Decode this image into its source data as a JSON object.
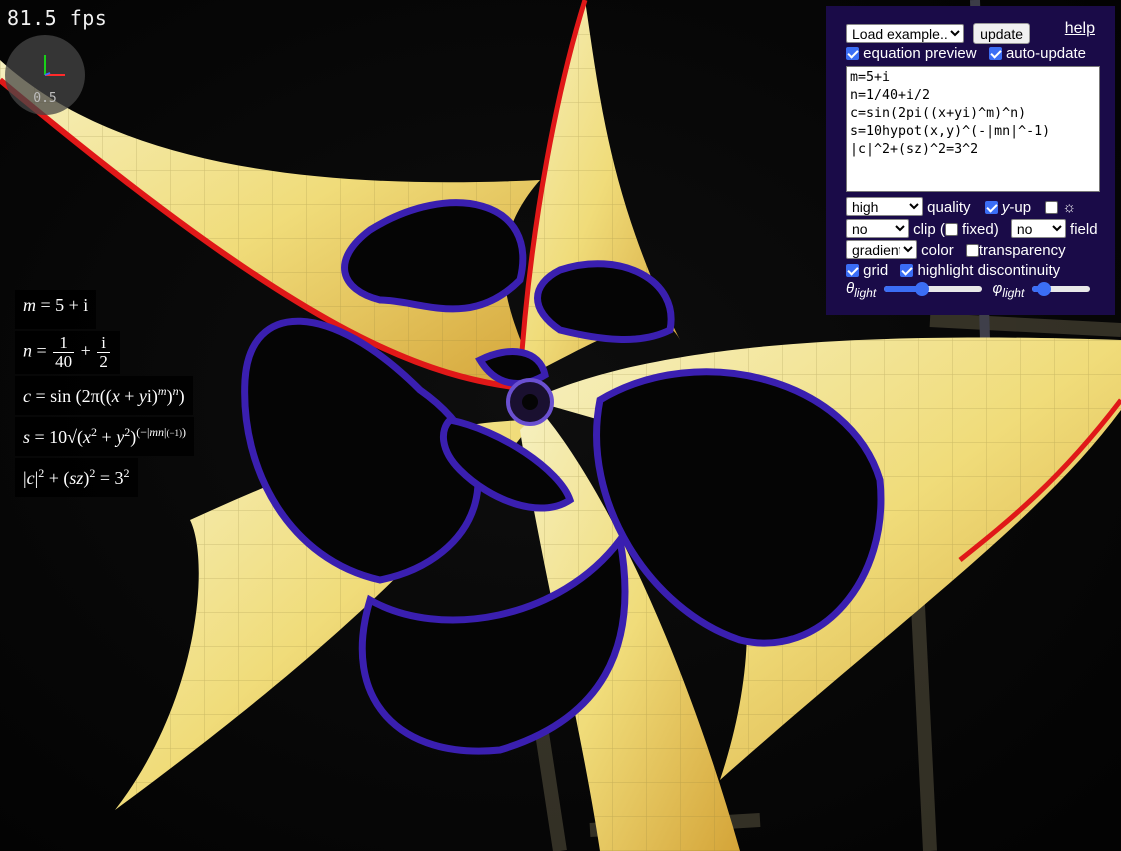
{
  "fps": "81.5 fps",
  "axes_widget": {
    "scale": "0.5",
    "icon": "axes-icon",
    "colors": {
      "x": "#ff2a2a",
      "y": "#18d018",
      "z": "#3a6bff"
    }
  },
  "equation_preview": [
    "m = 5 + i",
    "n = 1/40 + i/2",
    "c = sin(2π((x + yi)^m)^n)",
    "s = 10 sqrt(x^2 + y^2)^(-|mn|^(-1))",
    "|c|^2 + (sz)^2 = 3^2"
  ],
  "panel": {
    "example_select": "Load example...",
    "update_button": "update",
    "help_link": "help",
    "equation_preview_label": "equation preview",
    "equation_preview_checked": true,
    "auto_update_label": "auto-update",
    "auto_update_checked": true,
    "expression": "m=5+i\nn=1/40+i/2\nc=sin(2pi((x+yi)^m)^n)\ns=10hypot(x,y)^(-|mn|^-1)\n|c|^2+(sz)^2=3^2",
    "quality_select": "high",
    "quality_label": "quality",
    "y_up_prefix": "y",
    "y_up_label": "-up",
    "y_up_checked": true,
    "sun_checked": false,
    "sun_icon": "☼",
    "clip_select": "no",
    "clip_label": "clip (",
    "fixed_label": "fixed)",
    "fixed_checked": false,
    "field_select": "no",
    "field_label": "field",
    "color_select": "gradient",
    "color_label": "color",
    "transparency_label": "transparency",
    "transparency_checked": false,
    "grid_label": "grid",
    "grid_checked": true,
    "highlight_label": "highlight discontinuity",
    "highlight_checked": true,
    "theta_symbol": "θ",
    "theta_sub": "light",
    "theta_value": 0.38,
    "phi_symbol": "φ",
    "phi_sub": "light",
    "phi_value": 0.2
  },
  "colors": {
    "panel_bg": "#1a0b48",
    "accent": "#3b6ef5",
    "surface": "#f3e08a",
    "edge": "#e01818",
    "fringe": "#3a1fb0"
  }
}
